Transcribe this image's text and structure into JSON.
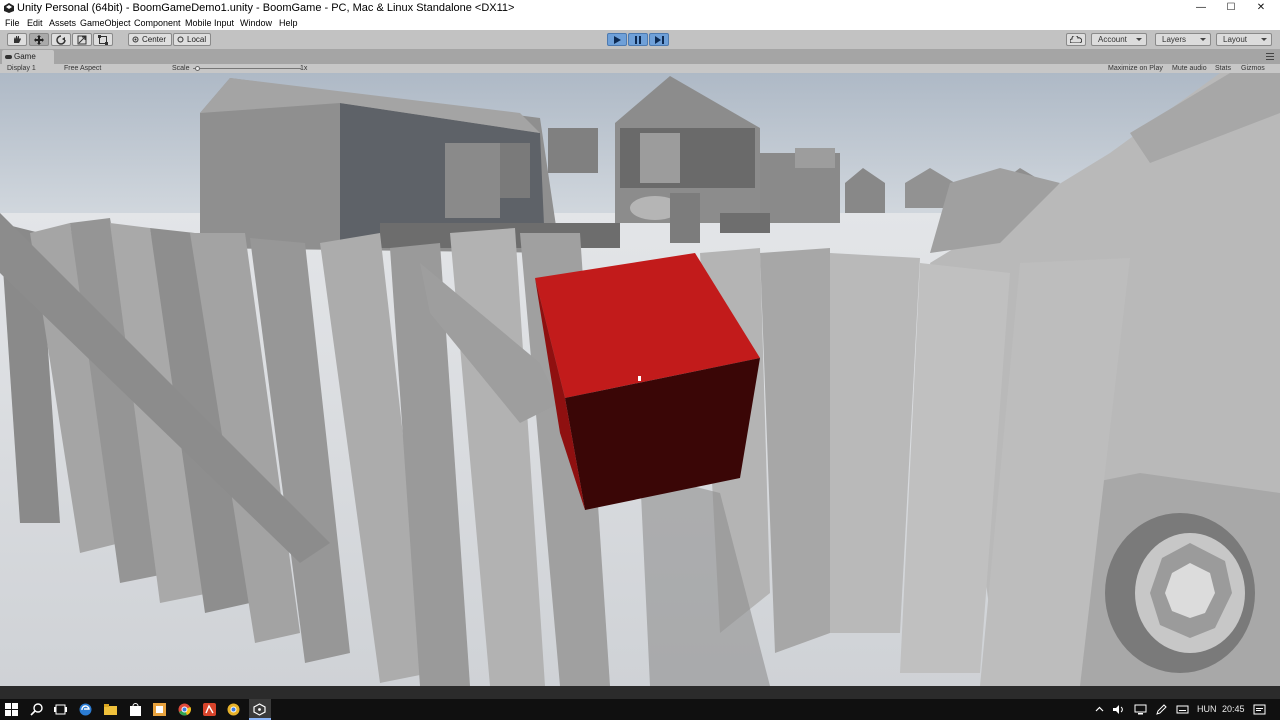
{
  "window": {
    "title": "Unity Personal (64bit) - BoomGameDemo1.unity - BoomGame - PC, Mac & Linux Standalone <DX11>",
    "minimize_glyph": "—",
    "maximize_glyph": "☐",
    "close_glyph": "✕"
  },
  "menu": {
    "items": [
      "File",
      "Edit",
      "Assets",
      "GameObject",
      "Component",
      "Mobile Input",
      "Window",
      "Help"
    ]
  },
  "toolbar": {
    "pivot_label": "Center",
    "space_label": "Local",
    "account_label": "Account",
    "layers_label": "Layers",
    "layout_label": "Layout"
  },
  "game_panel": {
    "tab_label": "Game",
    "display_label": "Display 1",
    "aspect_label": "Free Aspect",
    "scale_label": "Scale",
    "scale_value": "1x",
    "maximize_label": "Maximize on Play",
    "mute_label": "Mute audio",
    "stats_label": "Stats",
    "gizmos_label": "Gizmos"
  },
  "scene": {
    "sky_color": "#c9d2db",
    "ground_color": "#e6e8ea",
    "cube_color": "#c01a1a",
    "fence_color": "#9a9a9a"
  },
  "taskbar": {
    "language": "HUN",
    "time": "20:45"
  }
}
